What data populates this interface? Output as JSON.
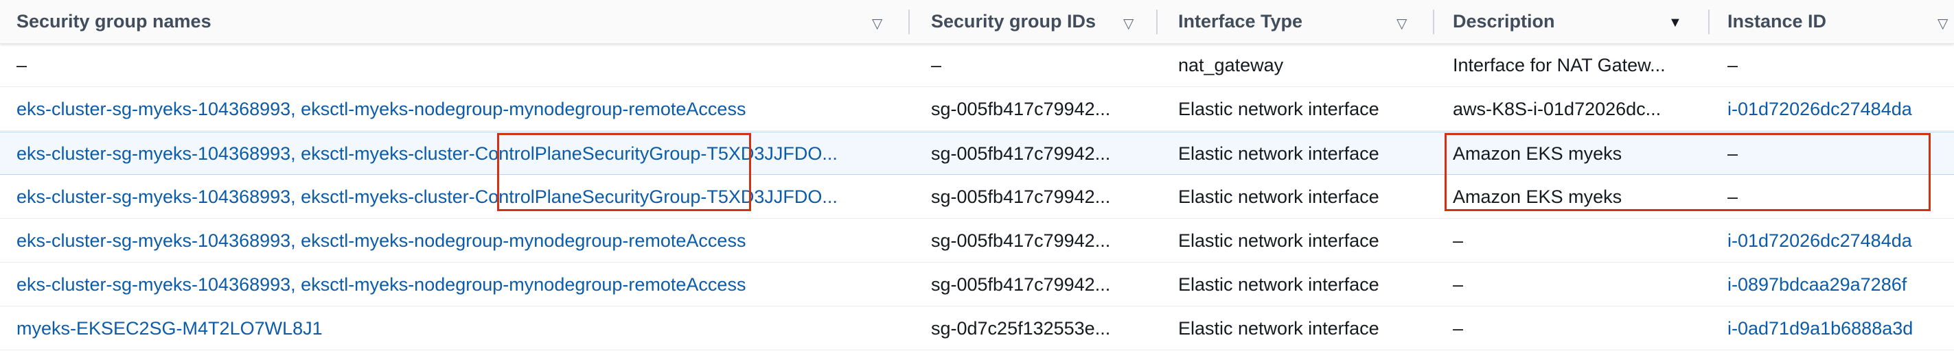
{
  "columns": [
    {
      "label": "Security group names",
      "sort": "▽"
    },
    {
      "label": "Security group IDs",
      "sort": "▽"
    },
    {
      "label": "Interface Type",
      "sort": "▽"
    },
    {
      "label": "Description",
      "sort": "▼"
    },
    {
      "label": "Instance ID",
      "sort": "▽"
    }
  ],
  "rows": [
    {
      "sg_names": "–",
      "sg_names_link": false,
      "sg_ids": "–",
      "type": "nat_gateway",
      "description": "Interface for NAT Gatew...",
      "instance": "–",
      "instance_link": false
    },
    {
      "sg_names": "eks-cluster-sg-myeks-104368993, eksctl-myeks-nodegroup-mynodegroup-remoteAccess",
      "sg_names_link": true,
      "sg_ids": "sg-005fb417c79942...",
      "type": "Elastic network interface",
      "description": "aws-K8S-i-01d72026dc...",
      "instance": "i-01d72026dc27484da",
      "instance_link": true
    },
    {
      "sg_names": "eks-cluster-sg-myeks-104368993, eksctl-myeks-cluster-ControlPlaneSecurityGroup-T5XD3JJFDO...",
      "sg_names_link": true,
      "sg_ids": "sg-005fb417c79942...",
      "type": "Elastic network interface",
      "description": "Amazon EKS myeks",
      "instance": "–",
      "instance_link": false
    },
    {
      "sg_names": "eks-cluster-sg-myeks-104368993, eksctl-myeks-cluster-ControlPlaneSecurityGroup-T5XD3JJFDO...",
      "sg_names_link": true,
      "sg_ids": "sg-005fb417c79942...",
      "type": "Elastic network interface",
      "description": "Amazon EKS myeks",
      "instance": "–",
      "instance_link": false
    },
    {
      "sg_names": "eks-cluster-sg-myeks-104368993, eksctl-myeks-nodegroup-mynodegroup-remoteAccess",
      "sg_names_link": true,
      "sg_ids": "sg-005fb417c79942...",
      "type": "Elastic network interface",
      "description": "–",
      "instance": "i-01d72026dc27484da",
      "instance_link": true
    },
    {
      "sg_names": "eks-cluster-sg-myeks-104368993, eksctl-myeks-nodegroup-mynodegroup-remoteAccess",
      "sg_names_link": true,
      "sg_ids": "sg-005fb417c79942...",
      "type": "Elastic network interface",
      "description": "–",
      "instance": "i-0897bdcaa29a7286f",
      "instance_link": true
    },
    {
      "sg_names": "myeks-EKSEC2SG-M4T2LO7WL8J1",
      "sg_names_link": true,
      "sg_ids": "sg-0d7c25f132553e...",
      "type": "Elastic network interface",
      "description": "–",
      "instance": "i-0ad71d9a1b6888a3d",
      "instance_link": true
    }
  ],
  "colors": {
    "link": "#0a5cab",
    "text": "#16191f",
    "highlight": "#d13212",
    "header_bg": "#fafafa"
  }
}
